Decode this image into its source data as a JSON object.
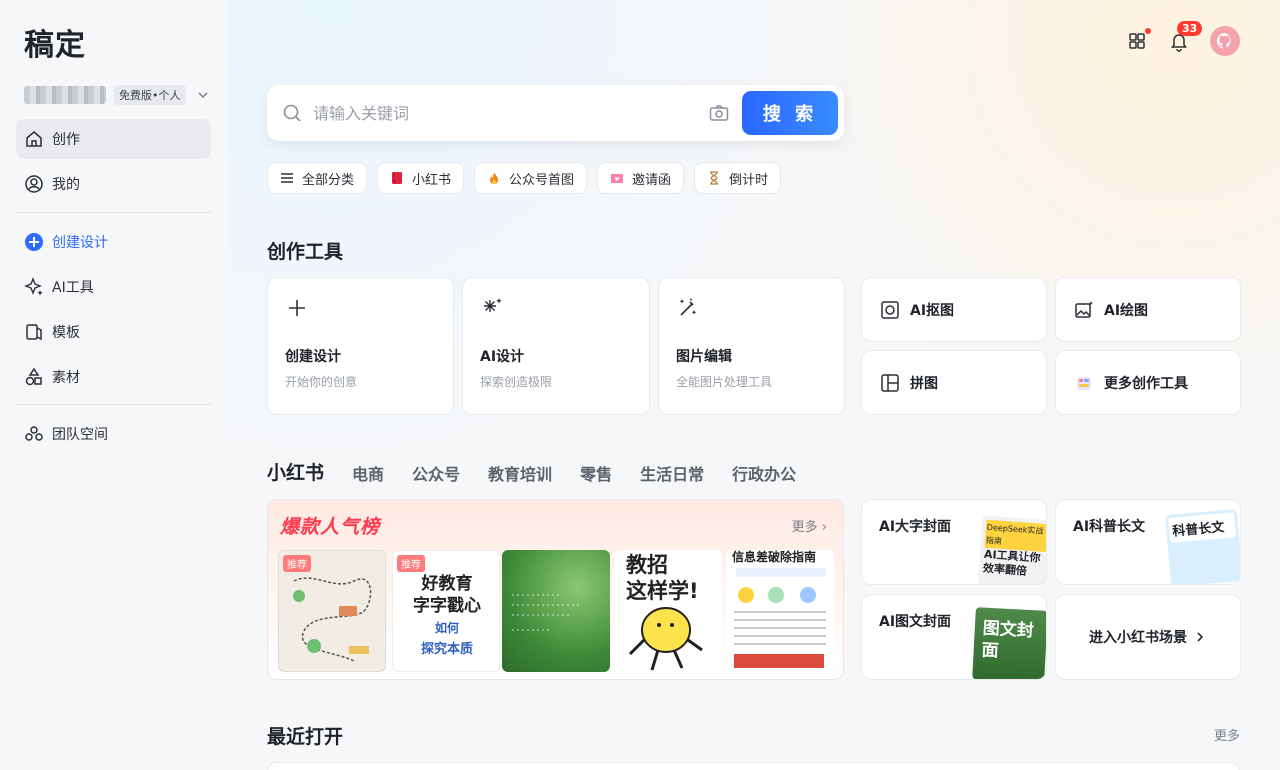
{
  "app": {
    "logo": "稿定"
  },
  "account": {
    "plan": "免费版•个人"
  },
  "nav": {
    "create": "创作",
    "mine": "我的",
    "new_design": "创建设计",
    "ai_tools": "AI工具",
    "templates": "模板",
    "materials": "素材",
    "team": "团队空间"
  },
  "header": {
    "notifications": "33"
  },
  "search": {
    "placeholder": "请输入关键词",
    "button": "搜 索"
  },
  "chips": [
    "全部分类",
    "小红书",
    "公众号首图",
    "邀请函",
    "倒计时"
  ],
  "tools": {
    "title": "创作工具",
    "cards": [
      {
        "title": "创建设计",
        "sub": "开始你的创意"
      },
      {
        "title": "AI设计",
        "sub": "探索创造极限"
      },
      {
        "title": "图片编辑",
        "sub": "全能图片处理工具"
      }
    ],
    "small": [
      "AI抠图",
      "AI绘图",
      "拼图",
      "更多创作工具"
    ]
  },
  "scene_tabs": [
    "小红书",
    "电商",
    "公众号",
    "教育培训",
    "零售",
    "生活日常",
    "行政办公"
  ],
  "hot": {
    "title": "爆款人气榜",
    "more": "更多",
    "tag": "推荐",
    "thumb2_line1": "好教育",
    "thumb2_line2": "字字戳心",
    "thumb2_line3": "如何",
    "thumb2_line4": "探究本质",
    "thumb4_line1": "教招",
    "thumb4_line2": "这样学!",
    "thumb5_title": "信息差破除指南"
  },
  "xhs_cards": {
    "c1": "AI大字封面",
    "c2": "AI科普长文",
    "c3": "AI图文封面",
    "c4": "进入小红书场景",
    "c1_art_top": "DeepSeek实战指南",
    "c1_art": "AI工具让你效率翻倍",
    "c2_art": "科普长文",
    "c3_art": "图文封面"
  },
  "recent": {
    "title": "最近打开",
    "more": "更多"
  }
}
